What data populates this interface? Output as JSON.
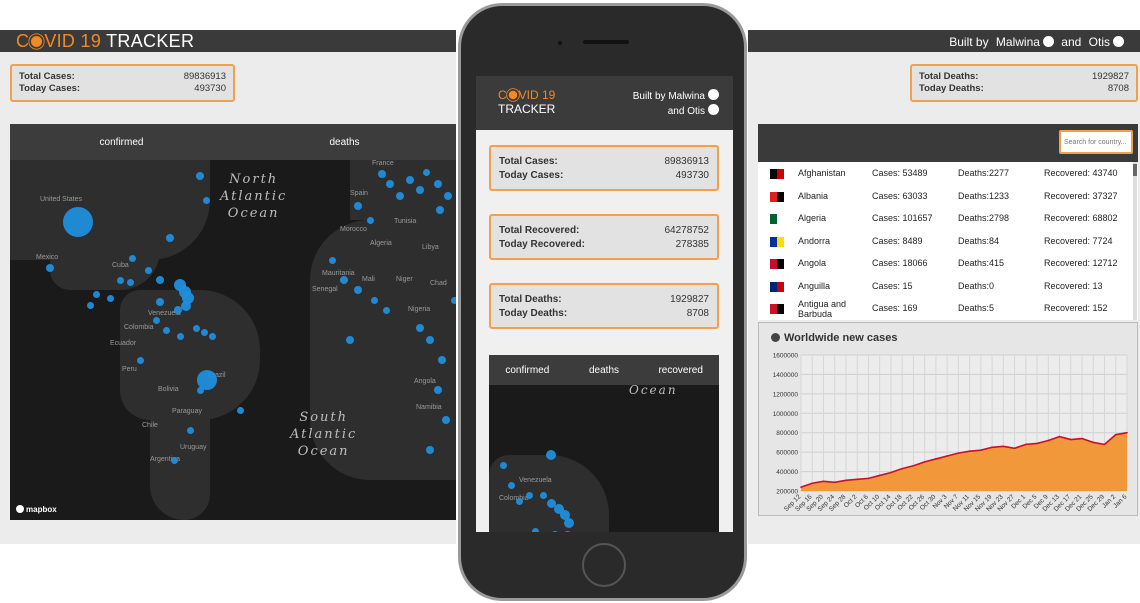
{
  "brand": {
    "c": "C",
    "vid": "VID 19",
    "tracker": "TRACKER"
  },
  "header": {
    "built_by": "Built by",
    "author1": "Malwina",
    "and": "and",
    "author2": "Otis"
  },
  "stats": {
    "total_cases_label": "Total Cases:",
    "total_cases": "89836913",
    "today_cases_label": "Today Cases:",
    "today_cases": "493730",
    "total_recovered_label": "Total Recovered:",
    "total_recovered": "64278752",
    "today_recovered_label": "Today Recovered:",
    "today_recovered": "278385",
    "total_deaths_label": "Total Deaths:",
    "total_deaths": "1929827",
    "today_deaths_label": "Today Deaths:",
    "today_deaths": "8708"
  },
  "map_tabs": {
    "confirmed": "confirmed",
    "deaths": "deaths",
    "recovered": "recovered"
  },
  "map": {
    "oceans": {
      "north_atlantic": "North\nAtlantic\nOcean",
      "south_atlantic": "South\nAtlantic\nOcean",
      "ocean": "Ocean"
    },
    "labels": {
      "united_states": "United States",
      "mexico": "Mexico",
      "cuba": "Cuba",
      "venezuela": "Venezuela",
      "colombia": "Colombia",
      "ecuador": "Ecuador",
      "peru": "Peru",
      "brazil": "Brazil",
      "bolivia": "Bolivia",
      "paraguay": "Paraguay",
      "chile": "Chile",
      "argentina": "Argentina",
      "uruguay": "Uruguay",
      "france": "France",
      "spain": "Spain",
      "morocco": "Morocco",
      "algeria": "Algeria",
      "tunisia": "Tunisia",
      "libya": "Libya",
      "mali": "Mali",
      "niger": "Niger",
      "mauritania": "Mauritania",
      "senegal": "Senegal",
      "nigeria": "Nigeria",
      "angola": "Angola",
      "namibia": "Namibia",
      "chad": "Chad"
    },
    "attribution": "mapbox"
  },
  "search": {
    "placeholder": "Search for country..."
  },
  "countries": [
    {
      "name": "Afghanistan",
      "cases": "Cases: 53489",
      "deaths": "Deaths:2277",
      "recovered": "Recovered: 43740"
    },
    {
      "name": "Albania",
      "cases": "Cases: 63033",
      "deaths": "Deaths:1233",
      "recovered": "Recovered: 37327"
    },
    {
      "name": "Algeria",
      "cases": "Cases: 101657",
      "deaths": "Deaths:2798",
      "recovered": "Recovered: 68802"
    },
    {
      "name": "Andorra",
      "cases": "Cases: 8489",
      "deaths": "Deaths:84",
      "recovered": "Recovered: 7724"
    },
    {
      "name": "Angola",
      "cases": "Cases: 18066",
      "deaths": "Deaths:415",
      "recovered": "Recovered: 12712"
    },
    {
      "name": "Anguilla",
      "cases": "Cases: 15",
      "deaths": "Deaths:0",
      "recovered": "Recovered: 13"
    },
    {
      "name": "Antigua and Barbuda",
      "cases": "Cases: 169",
      "deaths": "Deaths:5",
      "recovered": "Recovered: 152"
    }
  ],
  "colors": {
    "accent": "#f08a24",
    "map_dot": "#1f8fdc",
    "area_fill": "#f0983a",
    "line": "#c8102e"
  },
  "chart_data": {
    "type": "area",
    "title": "Worldwide new cases",
    "xlabel": "",
    "ylabel": "",
    "ylim": [
      200000,
      1600000
    ],
    "yticks": [
      "200000",
      "400000",
      "600000",
      "800000",
      "1000000",
      "1200000",
      "1400000",
      "1600000"
    ],
    "x": [
      "Sep 12",
      "Sep 16",
      "Sep 20",
      "Sep 24",
      "Sep 28",
      "Oct 2",
      "Oct 6",
      "Oct 10",
      "Oct 14",
      "Oct 18",
      "Oct 22",
      "Oct 26",
      "Oct 30",
      "Nov 3",
      "Nov 7",
      "Nov 11",
      "Nov 15",
      "Nov 19",
      "Nov 23",
      "Nov 27",
      "Dec 1",
      "Dec 5",
      "Dec 9",
      "Dec 13",
      "Dec 17",
      "Dec 21",
      "Dec 25",
      "Dec 29",
      "Jan 2",
      "Jan 6"
    ],
    "values": [
      240000,
      280000,
      300000,
      290000,
      310000,
      320000,
      330000,
      360000,
      390000,
      430000,
      460000,
      500000,
      530000,
      560000,
      590000,
      610000,
      620000,
      650000,
      660000,
      640000,
      680000,
      690000,
      720000,
      760000,
      730000,
      740000,
      700000,
      680000,
      780000,
      800000
    ],
    "grid": true,
    "legend": "none"
  }
}
